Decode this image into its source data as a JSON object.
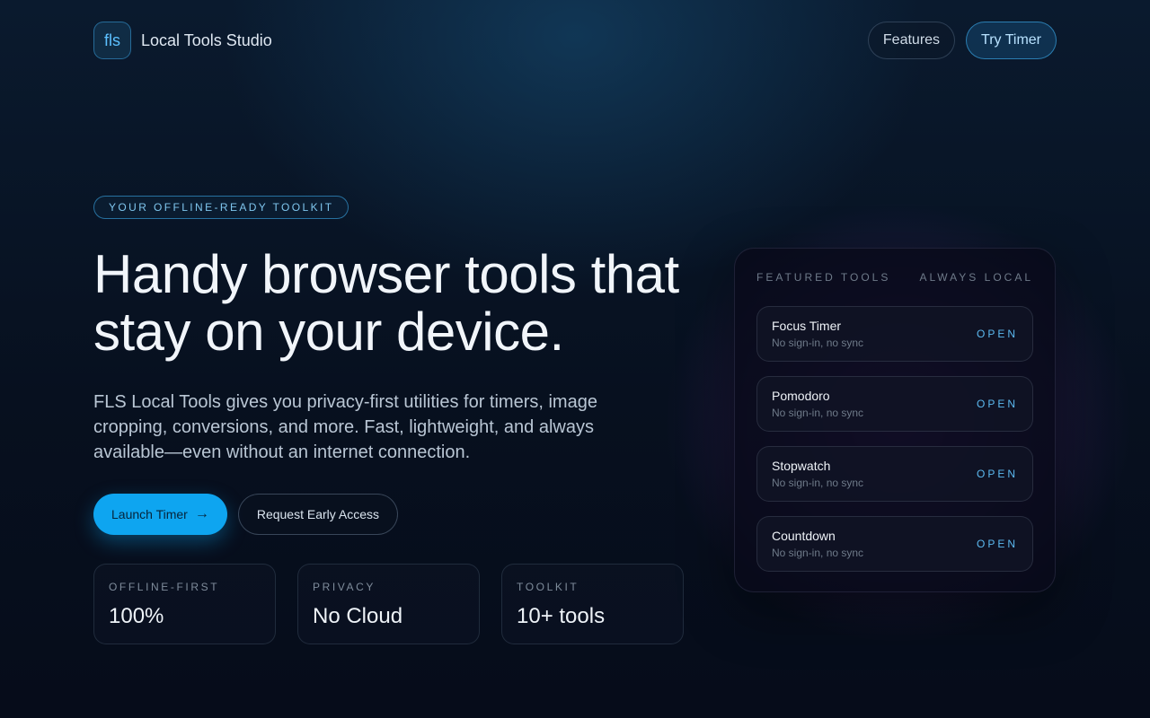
{
  "brand": {
    "logo": "fls",
    "name": "Local Tools Studio"
  },
  "nav": {
    "features": "Features",
    "try_timer": "Try Timer"
  },
  "hero": {
    "badge": "YOUR OFFLINE-READY TOOLKIT",
    "headline": "Handy browser tools that stay on your device.",
    "lede": "FLS Local Tools gives you privacy-first utilities for timers, image cropping, conversions, and more. Fast, lightweight, and always available—even without an internet connection.",
    "launch_label": "Launch Timer",
    "launch_icon": "→",
    "access_label": "Request Early Access"
  },
  "stats": [
    {
      "label": "OFFLINE-FIRST",
      "value": "100%"
    },
    {
      "label": "PRIVACY",
      "value": "No Cloud"
    },
    {
      "label": "TOOLKIT",
      "value": "10+ tools"
    }
  ],
  "panel": {
    "title": "FEATURED TOOLS",
    "tag": "ALWAYS LOCAL",
    "tools": [
      {
        "name": "Focus Timer",
        "sub": "No sign-in, no sync",
        "action": "OPEN"
      },
      {
        "name": "Pomodoro",
        "sub": "No sign-in, no sync",
        "action": "OPEN"
      },
      {
        "name": "Stopwatch",
        "sub": "No sign-in, no sync",
        "action": "OPEN"
      },
      {
        "name": "Countdown",
        "sub": "No sign-in, no sync",
        "action": "OPEN"
      }
    ]
  },
  "colors": {
    "accent": "#0ea5f0",
    "accent_text": "#5bb8ef",
    "background": "#07101f"
  }
}
